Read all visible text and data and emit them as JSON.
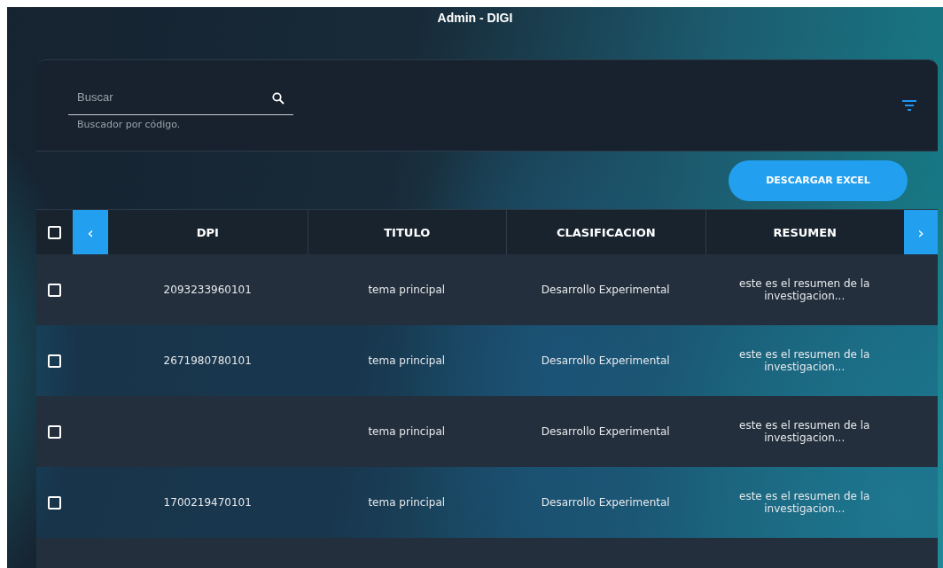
{
  "window": {
    "title": "Admin - DIGI"
  },
  "search": {
    "placeholder": "Buscar",
    "hint": "Buscador por código."
  },
  "toolbar": {
    "download_button": "DESCARGAR EXCEL"
  },
  "table": {
    "select_all": {
      "checked": false
    },
    "prev_button": "‹",
    "next_button": "›",
    "columns": [
      "DPI",
      "TITULO",
      "CLASIFICACION",
      "RESUMEN"
    ],
    "rows": [
      {
        "checked": false,
        "dpi": "2093233960101",
        "titulo": "tema principal",
        "clasificacion": "Desarrollo Experimental",
        "resumen": "este es el resumen de la investigacion..."
      },
      {
        "checked": false,
        "dpi": "2671980780101",
        "titulo": "tema principal",
        "clasificacion": "Desarrollo Experimental",
        "resumen": "este es el resumen de la investigacion..."
      },
      {
        "checked": false,
        "titulo": "tema principal",
        "clasificacion": "Desarrollo Experimental",
        "resumen": "este es el resumen de la investigacion..."
      },
      {
        "checked": false,
        "dpi": "1700219470101",
        "titulo": "tema principal",
        "clasificacion": "Desarrollo Experimental",
        "resumen": "este es el resumen de la investigacion..."
      }
    ]
  }
}
